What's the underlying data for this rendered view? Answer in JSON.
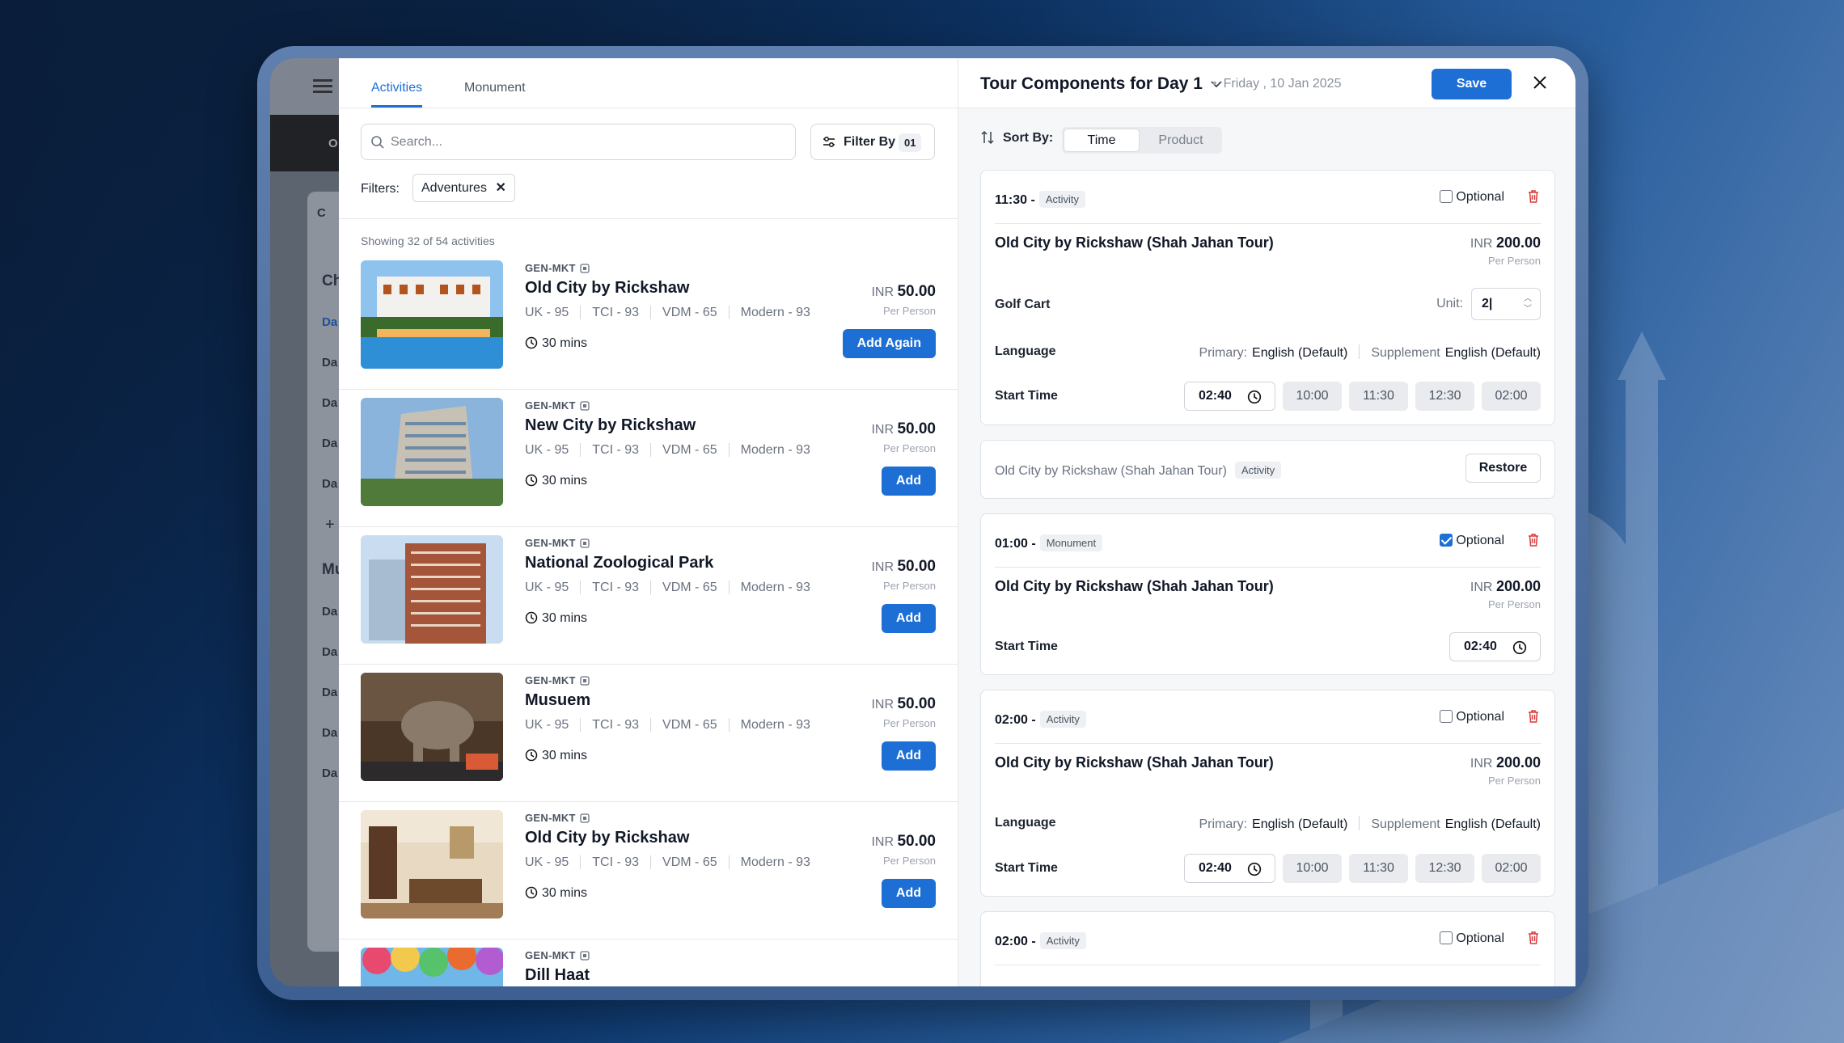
{
  "left": {
    "tabs": [
      "Activities",
      "Monument"
    ],
    "search_placeholder": "Search...",
    "filter_label": "Filter By",
    "filter_count": "01",
    "filters_label": "Filters:",
    "filter_chip": "Adventures",
    "showing": "Showing 32 of 54 activities",
    "activities": [
      {
        "code": "GEN-MKT",
        "name": "Old City by Rickshaw",
        "meta": [
          "UK - 95",
          "TCI - 93",
          "VDM - 65",
          "Modern - 93"
        ],
        "duration": "30 mins",
        "currency": "INR",
        "price": "50.00",
        "per": "Per Person",
        "button": "Add Again"
      },
      {
        "code": "GEN-MKT",
        "name": "New City by Rickshaw",
        "meta": [
          "UK - 95",
          "TCI - 93",
          "VDM - 65",
          "Modern - 93"
        ],
        "duration": "30 mins",
        "currency": "INR",
        "price": "50.00",
        "per": "Per Person",
        "button": "Add"
      },
      {
        "code": "GEN-MKT",
        "name": "National Zoological Park",
        "meta": [
          "UK - 95",
          "TCI - 93",
          "VDM - 65",
          "Modern - 93"
        ],
        "duration": "30 mins",
        "currency": "INR",
        "price": "50.00",
        "per": "Per Person",
        "button": "Add"
      },
      {
        "code": "GEN-MKT",
        "name": "Musuem",
        "meta": [
          "UK - 95",
          "TCI - 93",
          "VDM - 65",
          "Modern - 93"
        ],
        "duration": "30 mins",
        "currency": "INR",
        "price": "50.00",
        "per": "Per Person",
        "button": "Add"
      },
      {
        "code": "GEN-MKT",
        "name": "Old City by Rickshaw",
        "meta": [
          "UK - 95",
          "TCI - 93",
          "VDM - 65",
          "Modern - 93"
        ],
        "duration": "30 mins",
        "currency": "INR",
        "price": "50.00",
        "per": "Per Person",
        "button": "Add"
      },
      {
        "code": "GEN-MKT",
        "name": "Dill Haat"
      }
    ]
  },
  "right": {
    "title": "Tour Components for Day 1",
    "date": "Friday , 10 Jan 2025",
    "save": "Save",
    "sort_label": "Sort By:",
    "sort_options": [
      "Time",
      "Product"
    ],
    "optional_label": "Optional",
    "start_time_label": "Start Time",
    "card1": {
      "time": "11:30 -",
      "badge": "Activity",
      "name": "Old City by Rickshaw (Shah Jahan Tour)",
      "currency": "INR",
      "price": "200.00",
      "per": "Per Person",
      "extra_label": "Golf Cart",
      "unit_label": "Unit:",
      "unit_value": "2|",
      "language_label": "Language",
      "primary_label": "Primary:",
      "primary_value": "English (Default)",
      "supplement_label": "Supplement",
      "supplement_value": "English (Default)",
      "selected_time": "02:40",
      "time_options": [
        "10:00",
        "11:30",
        "12:30",
        "02:00"
      ]
    },
    "removed": {
      "name": "Old City by Rickshaw (Shah Jahan Tour)",
      "badge": "Activity",
      "restore": "Restore"
    },
    "card2": {
      "time": "01:00 -",
      "badge": "Monument",
      "name": "Old City by Rickshaw (Shah Jahan Tour)",
      "currency": "INR",
      "price": "200.00",
      "per": "Per Person",
      "selected_time": "02:40"
    },
    "card3": {
      "time": "02:00 -",
      "badge": "Activity",
      "name": "Old City by Rickshaw (Shah Jahan Tour)",
      "currency": "INR",
      "price": "200.00",
      "per": "Per Person",
      "language_label": "Language",
      "primary_label": "Primary:",
      "primary_value": "English (Default)",
      "supplement_label": "Supplement",
      "supplement_value": "English (Default)",
      "selected_time": "02:40",
      "time_options": [
        "10:00",
        "11:30",
        "12:30",
        "02:00"
      ]
    },
    "card4": {
      "time": "02:00 -",
      "badge": "Activity"
    }
  },
  "background_app": {
    "letters": [
      "O",
      "C",
      "Ch",
      "Da",
      "Da",
      "Da",
      "Da",
      "Da",
      "+",
      "Mu",
      "Da",
      "Da",
      "Da",
      "Da",
      "Da"
    ]
  },
  "colors": {
    "accent": "#1d6fd6",
    "danger": "#d9383a"
  }
}
